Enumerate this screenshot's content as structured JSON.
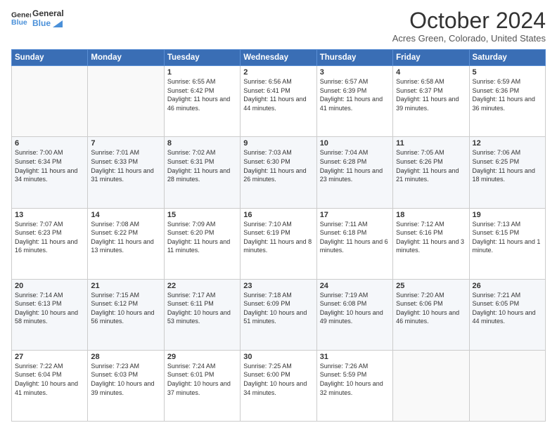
{
  "header": {
    "logo_line1": "General",
    "logo_line2": "Blue",
    "month": "October 2024",
    "location": "Acres Green, Colorado, United States"
  },
  "weekdays": [
    "Sunday",
    "Monday",
    "Tuesday",
    "Wednesday",
    "Thursday",
    "Friday",
    "Saturday"
  ],
  "weeks": [
    [
      {
        "day": "",
        "info": ""
      },
      {
        "day": "",
        "info": ""
      },
      {
        "day": "1",
        "info": "Sunrise: 6:55 AM\nSunset: 6:42 PM\nDaylight: 11 hours and 46 minutes."
      },
      {
        "day": "2",
        "info": "Sunrise: 6:56 AM\nSunset: 6:41 PM\nDaylight: 11 hours and 44 minutes."
      },
      {
        "day": "3",
        "info": "Sunrise: 6:57 AM\nSunset: 6:39 PM\nDaylight: 11 hours and 41 minutes."
      },
      {
        "day": "4",
        "info": "Sunrise: 6:58 AM\nSunset: 6:37 PM\nDaylight: 11 hours and 39 minutes."
      },
      {
        "day": "5",
        "info": "Sunrise: 6:59 AM\nSunset: 6:36 PM\nDaylight: 11 hours and 36 minutes."
      }
    ],
    [
      {
        "day": "6",
        "info": "Sunrise: 7:00 AM\nSunset: 6:34 PM\nDaylight: 11 hours and 34 minutes."
      },
      {
        "day": "7",
        "info": "Sunrise: 7:01 AM\nSunset: 6:33 PM\nDaylight: 11 hours and 31 minutes."
      },
      {
        "day": "8",
        "info": "Sunrise: 7:02 AM\nSunset: 6:31 PM\nDaylight: 11 hours and 28 minutes."
      },
      {
        "day": "9",
        "info": "Sunrise: 7:03 AM\nSunset: 6:30 PM\nDaylight: 11 hours and 26 minutes."
      },
      {
        "day": "10",
        "info": "Sunrise: 7:04 AM\nSunset: 6:28 PM\nDaylight: 11 hours and 23 minutes."
      },
      {
        "day": "11",
        "info": "Sunrise: 7:05 AM\nSunset: 6:26 PM\nDaylight: 11 hours and 21 minutes."
      },
      {
        "day": "12",
        "info": "Sunrise: 7:06 AM\nSunset: 6:25 PM\nDaylight: 11 hours and 18 minutes."
      }
    ],
    [
      {
        "day": "13",
        "info": "Sunrise: 7:07 AM\nSunset: 6:23 PM\nDaylight: 11 hours and 16 minutes."
      },
      {
        "day": "14",
        "info": "Sunrise: 7:08 AM\nSunset: 6:22 PM\nDaylight: 11 hours and 13 minutes."
      },
      {
        "day": "15",
        "info": "Sunrise: 7:09 AM\nSunset: 6:20 PM\nDaylight: 11 hours and 11 minutes."
      },
      {
        "day": "16",
        "info": "Sunrise: 7:10 AM\nSunset: 6:19 PM\nDaylight: 11 hours and 8 minutes."
      },
      {
        "day": "17",
        "info": "Sunrise: 7:11 AM\nSunset: 6:18 PM\nDaylight: 11 hours and 6 minutes."
      },
      {
        "day": "18",
        "info": "Sunrise: 7:12 AM\nSunset: 6:16 PM\nDaylight: 11 hours and 3 minutes."
      },
      {
        "day": "19",
        "info": "Sunrise: 7:13 AM\nSunset: 6:15 PM\nDaylight: 11 hours and 1 minute."
      }
    ],
    [
      {
        "day": "20",
        "info": "Sunrise: 7:14 AM\nSunset: 6:13 PM\nDaylight: 10 hours and 58 minutes."
      },
      {
        "day": "21",
        "info": "Sunrise: 7:15 AM\nSunset: 6:12 PM\nDaylight: 10 hours and 56 minutes."
      },
      {
        "day": "22",
        "info": "Sunrise: 7:17 AM\nSunset: 6:11 PM\nDaylight: 10 hours and 53 minutes."
      },
      {
        "day": "23",
        "info": "Sunrise: 7:18 AM\nSunset: 6:09 PM\nDaylight: 10 hours and 51 minutes."
      },
      {
        "day": "24",
        "info": "Sunrise: 7:19 AM\nSunset: 6:08 PM\nDaylight: 10 hours and 49 minutes."
      },
      {
        "day": "25",
        "info": "Sunrise: 7:20 AM\nSunset: 6:06 PM\nDaylight: 10 hours and 46 minutes."
      },
      {
        "day": "26",
        "info": "Sunrise: 7:21 AM\nSunset: 6:05 PM\nDaylight: 10 hours and 44 minutes."
      }
    ],
    [
      {
        "day": "27",
        "info": "Sunrise: 7:22 AM\nSunset: 6:04 PM\nDaylight: 10 hours and 41 minutes."
      },
      {
        "day": "28",
        "info": "Sunrise: 7:23 AM\nSunset: 6:03 PM\nDaylight: 10 hours and 39 minutes."
      },
      {
        "day": "29",
        "info": "Sunrise: 7:24 AM\nSunset: 6:01 PM\nDaylight: 10 hours and 37 minutes."
      },
      {
        "day": "30",
        "info": "Sunrise: 7:25 AM\nSunset: 6:00 PM\nDaylight: 10 hours and 34 minutes."
      },
      {
        "day": "31",
        "info": "Sunrise: 7:26 AM\nSunset: 5:59 PM\nDaylight: 10 hours and 32 minutes."
      },
      {
        "day": "",
        "info": ""
      },
      {
        "day": "",
        "info": ""
      }
    ]
  ]
}
